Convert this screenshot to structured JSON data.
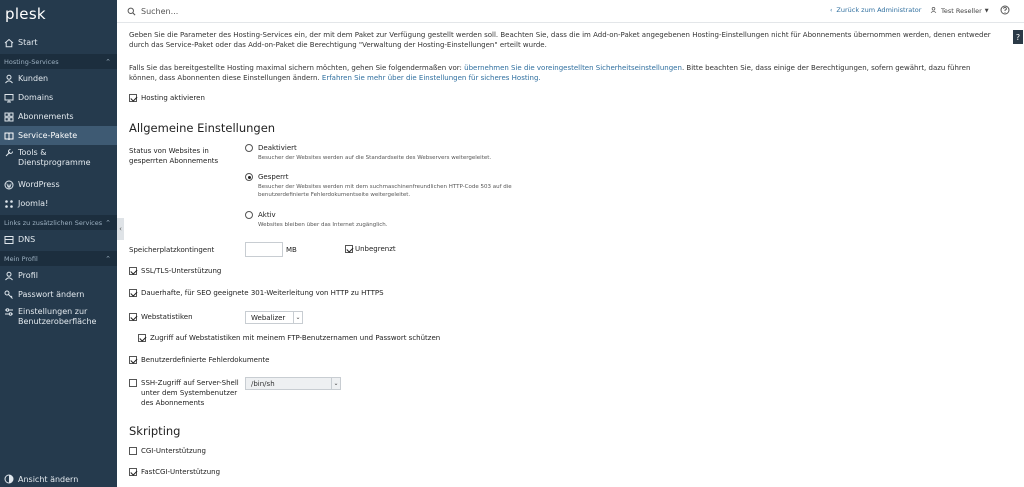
{
  "sidebar": {
    "logo": "plesk",
    "start": "Start",
    "groups": {
      "hosting": "Hosting-Services",
      "links": "Links zu zusätzlichen Services",
      "profile": "Mein Profil"
    },
    "items": {
      "kunden": "Kunden",
      "domains": "Domains",
      "abonnements": "Abonnements",
      "service_pakete": "Service-Pakete",
      "tools": "Tools & Dienstprogramme",
      "wordpress": "WordPress",
      "joomla": "Joomla!",
      "dns": "DNS",
      "profil": "Profil",
      "passwort": "Passwort ändern",
      "einstellungen": "Einstellungen zur Benutzeroberfläche"
    },
    "footer": "Ansicht ändern"
  },
  "topbar": {
    "search_placeholder": "Suchen...",
    "back_link": "Zurück zum Administrator",
    "user": "Test Reseller"
  },
  "main": {
    "intro1": "Geben Sie die Parameter des Hosting-Services ein, der mit dem Paket zur Verfügung gestellt werden soll. Beachten Sie, dass die im Add-on-Paket angegebenen Hosting-Einstellungen nicht für Abonnements übernommen werden, denen entweder durch das Service-Paket oder das Add-on-Paket die Berechtigung \"Verwaltung der Hosting-Einstellungen\" erteilt wurde.",
    "intro2_a": "Falls Sie das bereitgestellte Hosting maximal sichern möchten, gehen Sie folgendermaßen vor: ",
    "intro2_link1": "übernehmen Sie die voreingestellten Sicherheitseinstellungen",
    "intro2_b": ". Bitte beachten Sie, dass einige der Berechtigungen, sofern gewährt, dazu führen können, dass Abonnenten diese Einstellungen ändern. ",
    "intro2_link2": "Erfahren Sie mehr über die Einstellungen für sicheres Hosting.",
    "hosting_enable": "Hosting aktivieren",
    "section_general": "Allgemeine Einstellungen",
    "status_label": "Status von Websites in gesperrten Abonnements",
    "radio_deactivated": "Deaktiviert",
    "radio_deactivated_desc": "Besucher der Websites werden auf die Standardseite des Webservers weitergeleitet.",
    "radio_locked": "Gesperrt",
    "radio_locked_desc": "Besucher der Websites werden mit dem suchmaschinenfreundlichen HTTP-Code 503 auf die benutzerdefinierte Fehlerdokumentseite weitergeleitet.",
    "radio_active": "Aktiv",
    "radio_active_desc": "Websites bleiben über das Internet zugänglich.",
    "quota_label": "Speicherplatzkontingent",
    "quota_unit": "MB",
    "unlimited": "Unbegrenzt",
    "ssl": "SSL/TLS-Unterstützung",
    "redirect": "Dauerhafte, für SEO geeignete 301-Weiterleitung von HTTP zu HTTPS",
    "webstats": "Webstatistiken",
    "webstats_value": "Webalizer",
    "webstats_protect": "Zugriff auf Webstatistiken mit meinem FTP-Benutzernamen und Passwort schützen",
    "error_docs": "Benutzerdefinierte Fehlerdokumente",
    "ssh": "SSH-Zugriff auf Server-Shell unter dem Systembenutzer des Abonnements",
    "ssh_value": "/bin/sh",
    "section_scripting": "Skripting",
    "cgi": "CGI-Unterstützung",
    "fastcgi": "FastCGI-Unterstützung"
  }
}
